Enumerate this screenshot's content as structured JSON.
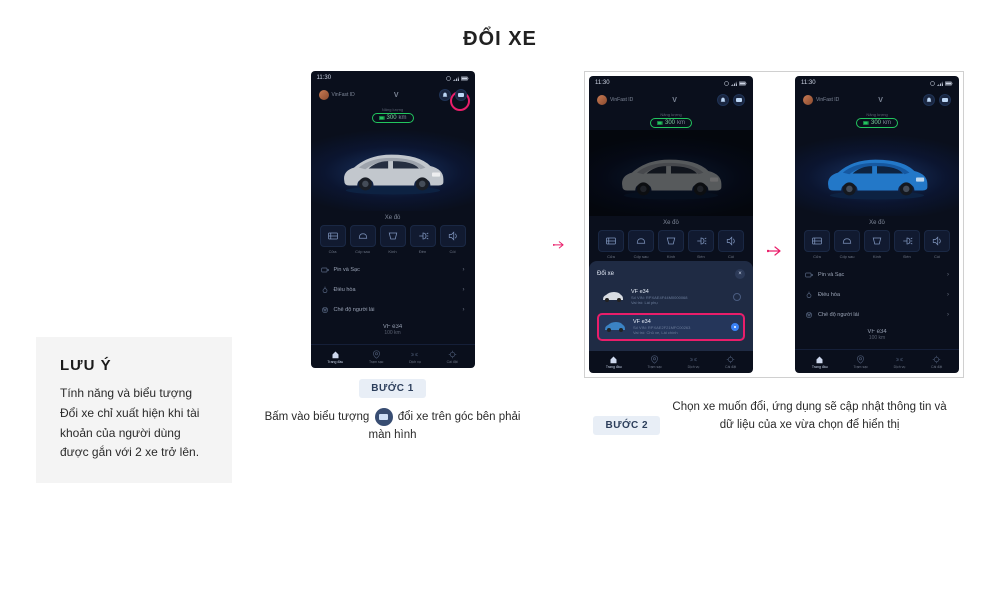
{
  "page_title": "ĐỔI XE",
  "note": {
    "title": "LƯU Ý",
    "text": "Tính năng và biểu tượng Đổi xe chỉ xuất hiện khi tài khoản của người dùng được gắn với 2 xe trở lên."
  },
  "phone_common": {
    "time": "11:30",
    "vinfast_id_label": "VinFast ID",
    "logo": "V",
    "range_label": "Năng lượng",
    "range_value": "300",
    "range_unit": "km",
    "car_name": "Xe đỗ",
    "model_name": "VF e34",
    "odometer": "100 km",
    "controls": [
      {
        "label": "Cửa"
      },
      {
        "label": "Cốp sau"
      },
      {
        "label": "Kính"
      },
      {
        "label": "Đèn"
      },
      {
        "label": "Còi"
      }
    ],
    "menu": [
      {
        "label": "Pin và Sạc"
      },
      {
        "label": "Điều hòa"
      },
      {
        "label": "Chế độ người lái"
      }
    ],
    "nav": [
      {
        "label": "Trang đầu"
      },
      {
        "label": "Trạm sạc"
      },
      {
        "label": "Dịch vụ"
      },
      {
        "label": "Cài đặt"
      }
    ]
  },
  "sheet": {
    "title": "Đổi xe",
    "close": "×",
    "options": [
      {
        "name": "VF e34",
        "vin": "Số VIN: RPXAE4F44M0000068",
        "role": "Vai trò: Lái phụ",
        "thumb_color": "#d8dce2"
      },
      {
        "name": "VF e34",
        "vin": "Số VIN: RPXAE2F21MFC00263",
        "role": "Vai trò: Chủ xe, Lái chính",
        "thumb_color": "#3b82c4"
      }
    ]
  },
  "step1": {
    "badge": "BƯỚC 1",
    "text_a": "Bấm vào biểu tượng",
    "text_b": "đổi xe trên góc bên phải màn hình"
  },
  "step2": {
    "badge": "BƯỚC 2",
    "text": "Chọn xe muốn đổi, ứng dụng sẽ cập nhật thông tin và dữ liệu của xe vừa chọn để hiển thị"
  }
}
